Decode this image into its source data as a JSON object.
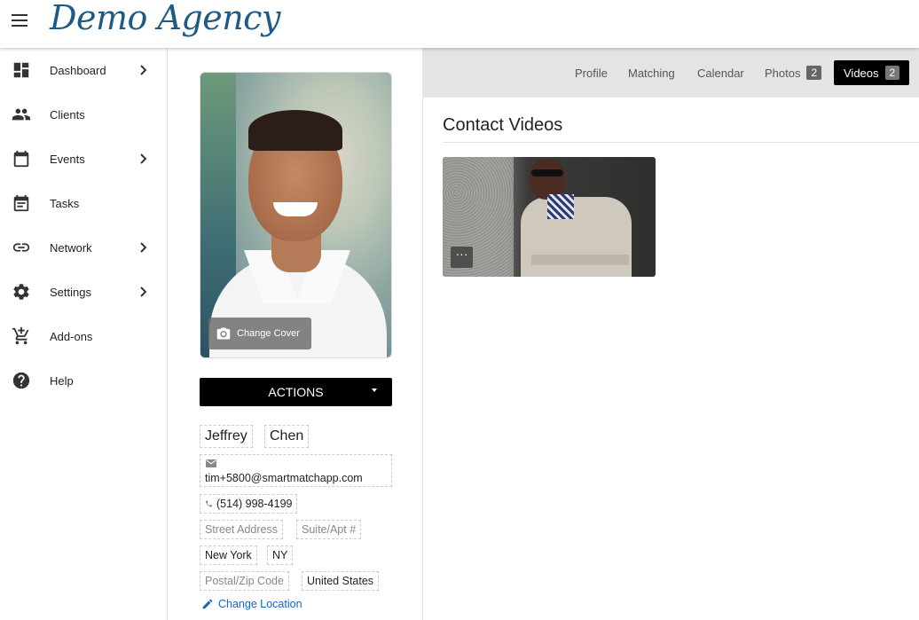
{
  "header": {
    "brand": "Demo Agency"
  },
  "sidebar": {
    "items": [
      {
        "label": "Dashboard",
        "icon": "dashboard-icon",
        "has_chevron": true
      },
      {
        "label": "Clients",
        "icon": "people-icon",
        "has_chevron": false
      },
      {
        "label": "Events",
        "icon": "calendar-icon",
        "has_chevron": true
      },
      {
        "label": "Tasks",
        "icon": "tasks-icon",
        "has_chevron": false
      },
      {
        "label": "Network",
        "icon": "link-icon",
        "has_chevron": true
      },
      {
        "label": "Settings",
        "icon": "gear-icon",
        "has_chevron": true
      },
      {
        "label": "Add-ons",
        "icon": "cart-icon",
        "has_chevron": false
      },
      {
        "label": "Help",
        "icon": "help-icon",
        "has_chevron": false
      }
    ]
  },
  "profile": {
    "change_cover": "Change Cover",
    "actions_label": "ACTIONS",
    "first_name": "Jeffrey",
    "last_name": "Chen",
    "email": "tim+5800@smartmatchapp.com",
    "phone": "(514) 998-4199",
    "street_placeholder": "Street Address",
    "suite_placeholder": "Suite/Apt #",
    "city": "New York",
    "state": "NY",
    "zip_placeholder": "Postal/Zip Code",
    "country": "United States",
    "change_location": "Change Location"
  },
  "tabs": [
    {
      "label": "Profile"
    },
    {
      "label": "Matching"
    },
    {
      "label": "Calendar"
    },
    {
      "label": "Photos",
      "badge": "2"
    },
    {
      "label": "Videos",
      "badge": "2",
      "active": true
    }
  ],
  "main": {
    "section_title": "Contact Videos",
    "more_label": "···"
  },
  "colors": {
    "brand": "#1f5a85",
    "active_tab_bg": "#000000",
    "tabbar_bg": "#e4e4e4",
    "link": "#1565c0"
  }
}
